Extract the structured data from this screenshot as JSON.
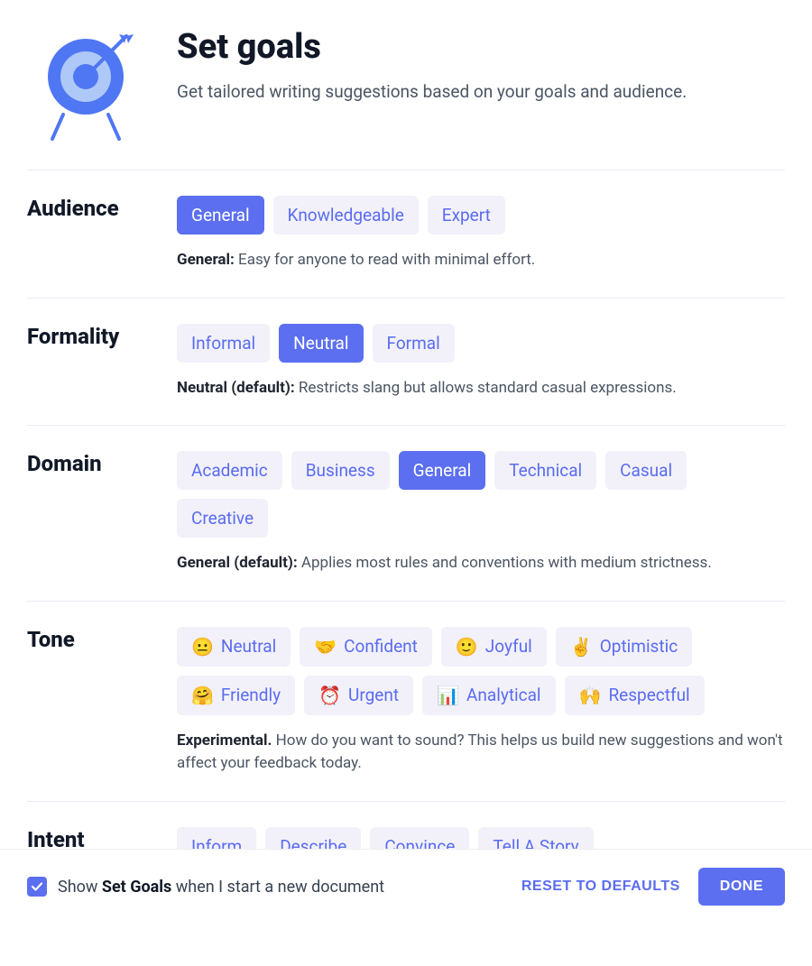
{
  "header": {
    "title": "Set goals",
    "subtitle": "Get tailored writing suggestions based on your goals and audience."
  },
  "sections": {
    "audience": {
      "label": "Audience",
      "options": [
        "General",
        "Knowledgeable",
        "Expert"
      ],
      "selected": "General",
      "help_strong": "General:",
      "help_rest": " Easy for anyone to read with minimal effort."
    },
    "formality": {
      "label": "Formality",
      "options": [
        "Informal",
        "Neutral",
        "Formal"
      ],
      "selected": "Neutral",
      "help_strong": "Neutral (default):",
      "help_rest": " Restricts slang but allows standard casual expressions."
    },
    "domain": {
      "label": "Domain",
      "options": [
        "Academic",
        "Business",
        "General",
        "Technical",
        "Casual",
        "Creative"
      ],
      "selected": "General",
      "help_strong": "General (default):",
      "help_rest": " Applies most rules and conventions with medium strictness."
    },
    "tone": {
      "label": "Tone",
      "options": [
        {
          "emoji": "😐",
          "label": "Neutral"
        },
        {
          "emoji": "🤝",
          "label": "Confident"
        },
        {
          "emoji": "🙂",
          "label": "Joyful"
        },
        {
          "emoji": "✌️",
          "label": "Optimistic"
        },
        {
          "emoji": "🤗",
          "label": "Friendly"
        },
        {
          "emoji": "⏰",
          "label": "Urgent"
        },
        {
          "emoji": "📊",
          "label": "Analytical"
        },
        {
          "emoji": "🙌",
          "label": "Respectful"
        }
      ],
      "help_strong": "Experimental.",
      "help_rest": " How do you want to sound? This helps us build new suggestions and won't affect your feedback today."
    },
    "intent": {
      "label": "Intent",
      "options": [
        "Inform",
        "Describe",
        "Convince",
        "Tell A Story"
      ]
    }
  },
  "footer": {
    "checkbox_pre": "Show ",
    "checkbox_strong": "Set Goals",
    "checkbox_post": " when I start a new document",
    "checked": true,
    "reset": "RESET TO DEFAULTS",
    "done": "DONE"
  }
}
